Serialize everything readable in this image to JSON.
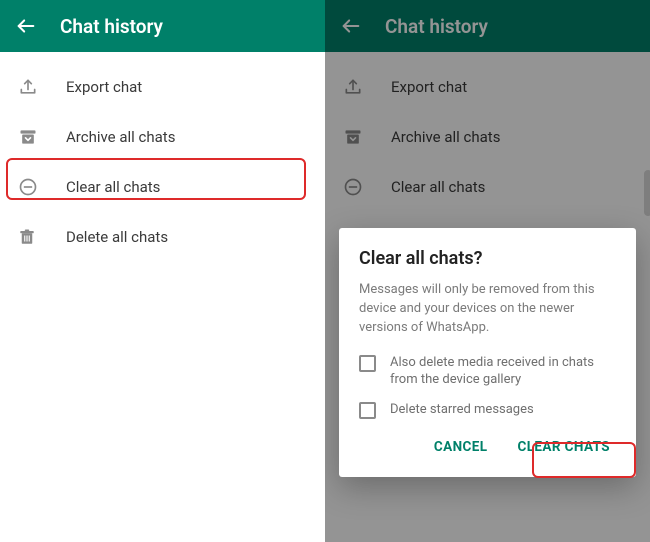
{
  "accent": "#008069",
  "highlight_color": "#de2a2a",
  "header": {
    "title": "Chat history"
  },
  "options": {
    "export": {
      "label": "Export chat",
      "icon": "upload-icon"
    },
    "archive": {
      "label": "Archive all chats",
      "icon": "archive-icon"
    },
    "clear": {
      "label": "Clear all chats",
      "icon": "minus-circle-icon"
    },
    "delete": {
      "label": "Delete all chats",
      "icon": "trash-icon"
    }
  },
  "dialog": {
    "title": "Clear all chats?",
    "body": "Messages will only be removed from this device and your devices on the newer versions of WhatsApp.",
    "checkbox_media": "Also delete media received in chats from the device gallery",
    "checkbox_starred": "Delete starred messages",
    "cancel": "CANCEL",
    "confirm": "CLEAR CHATS"
  }
}
